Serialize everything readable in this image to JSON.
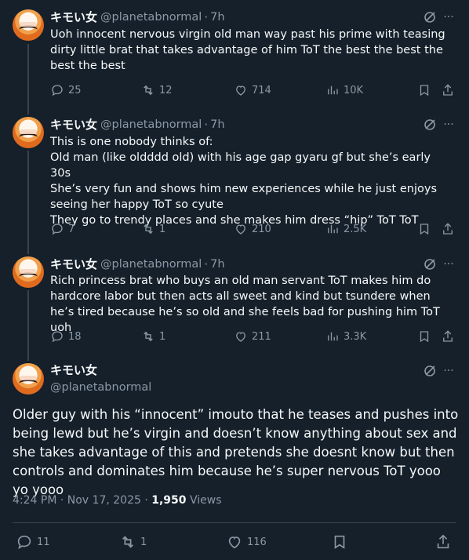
{
  "author": {
    "display_name": "キモい女",
    "handle": "@planetabnormal"
  },
  "replies": [
    {
      "time": "7h",
      "text": "Uoh innocent nervous virgin old man way past his prime with teasing dirty little brat that takes advantage of him ToT the best the best the best the best",
      "reply_count": "25",
      "repost_count": "12",
      "like_count": "714",
      "view_count": "10K"
    },
    {
      "time": "7h",
      "text": "This is one nobody thinks of:\nOld man (like oldddd old) with his age gap gyaru gf but she’s early 30s\nShe’s very fun and shows him new experiences while he just enjoys seeing her happy ToT so cyute\nThey go to trendy places and she makes him dress “hip” ToT ToT",
      "reply_count": "7",
      "repost_count": "1",
      "like_count": "210",
      "view_count": "2.5K"
    },
    {
      "time": "7h",
      "text": "Rich princess brat who buys an old man servant ToT makes him do hardcore labor but then acts all sweet and kind but tsundere when he’s tired because he’s so old and she feels bad for pushing him ToT uoh",
      "reply_count": "18",
      "repost_count": "1",
      "like_count": "211",
      "view_count": "3.3K"
    }
  ],
  "main_tweet": {
    "text": "Older guy with his “innocent” imouto that he teases and pushes into being lewd but he’s virgin and doesn’t know anything about sex and she takes advantage of this and pretends she doesnt know but then controls and dominates him because he’s super nervous ToT yooo yo yooo",
    "timestamp": "4:24 PM · Nov 17, 2025 ·",
    "views_number": "1,950",
    "views_label": "Views",
    "reply_count": "11",
    "repost_count": "1",
    "like_count": "116"
  },
  "ui": {
    "dot": "·",
    "more": "···"
  },
  "colors": {
    "background": "#15202b",
    "text": "#f7f9f9",
    "muted": "#8b98a5",
    "border": "#38444d"
  }
}
